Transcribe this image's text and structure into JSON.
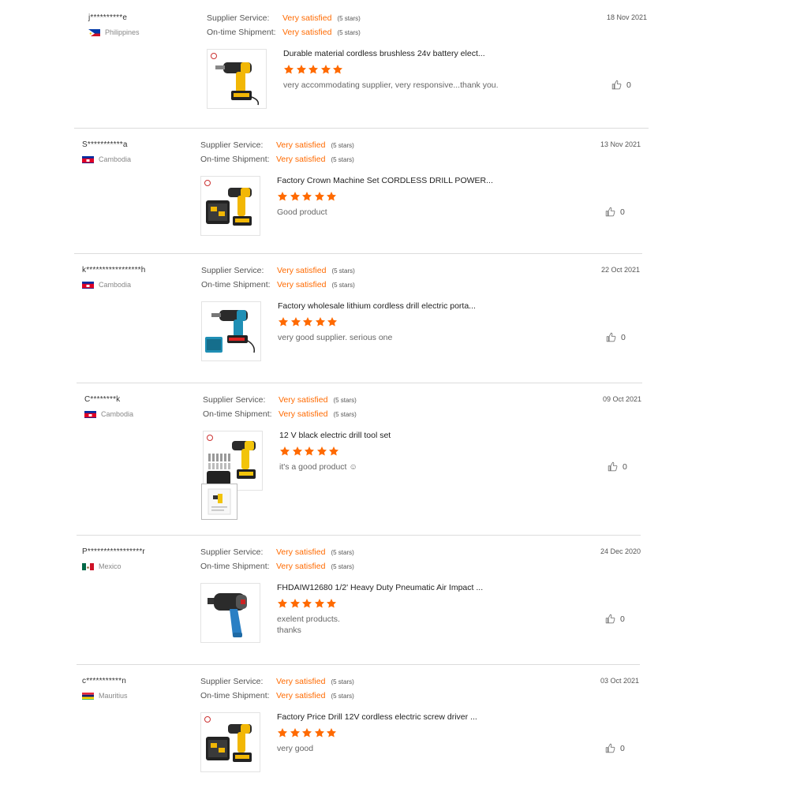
{
  "colors": {
    "accent": "#ff6a00",
    "divider": "#dcdcdc"
  },
  "reviews": [
    {
      "user": "j**********e",
      "country": "Philippines",
      "flag": "ph-flag-icon",
      "supplier_label": "Supplier Service:",
      "supplier_value": "Very satisfied",
      "supplier_stars": "(5 stars)",
      "shipment_label": "On-time Shipment:",
      "shipment_value": "Very satisfied",
      "shipment_stars": "(5 stars)",
      "date": "18 Nov 2021",
      "product_title": "Durable material cordless brushless 24v battery elect...",
      "rating": 5,
      "comment_lines": [
        "very accommodating supplier, very responsive...thank you."
      ],
      "likes": "0"
    },
    {
      "user": "S***********a",
      "country": "Cambodia",
      "flag": "kh-flag-icon",
      "supplier_label": "Supplier Service:",
      "supplier_value": "Very satisfied",
      "supplier_stars": "(5 stars)",
      "shipment_label": "On-time Shipment:",
      "shipment_value": "Very satisfied",
      "shipment_stars": "(5 stars)",
      "date": "13 Nov 2021",
      "product_title": "Factory Crown Machine Set CORDLESS DRILL POWER...",
      "rating": 5,
      "comment_lines": [
        "Good product"
      ],
      "likes": "0"
    },
    {
      "user": "k*****************h",
      "country": "Cambodia",
      "flag": "kh-flag-icon",
      "supplier_label": "Supplier Service:",
      "supplier_value": "Very satisfied",
      "supplier_stars": "(5 stars)",
      "shipment_label": "On-time Shipment:",
      "shipment_value": "Very satisfied",
      "shipment_stars": "(5 stars)",
      "date": "22 Oct 2021",
      "product_title": "Factory wholesale lithium cordless drill electric porta...",
      "rating": 5,
      "comment_lines": [
        "very good supplier. serious one"
      ],
      "likes": "0"
    },
    {
      "user": "C********k",
      "country": "Cambodia",
      "flag": "kh-flag-icon",
      "supplier_label": "Supplier Service:",
      "supplier_value": "Very satisfied",
      "supplier_stars": "(5 stars)",
      "shipment_label": "On-time Shipment:",
      "shipment_value": "Very satisfied",
      "shipment_stars": "(5 stars)",
      "date": "09 Oct 2021",
      "product_title": "12 V black electric drill tool set",
      "rating": 5,
      "comment_lines": [
        "it's a good product ☺"
      ],
      "likes": "0",
      "has_attachment": true
    },
    {
      "user": "P*****************r",
      "country": "Mexico",
      "flag": "mx-flag-icon",
      "supplier_label": "Supplier Service:",
      "supplier_value": "Very satisfied",
      "supplier_stars": "(5 stars)",
      "shipment_label": "On-time Shipment:",
      "shipment_value": "Very satisfied",
      "shipment_stars": "(5 stars)",
      "date": "24 Dec 2020",
      "product_title": "FHDAIW12680 1/2' Heavy Duty Pneumatic Air Impact ...",
      "rating": 5,
      "comment_lines": [
        "exelent products.",
        "thanks"
      ],
      "likes": "0"
    },
    {
      "user": "c***********n",
      "country": "Mauritius",
      "flag": "mu-flag-icon",
      "supplier_label": "Supplier Service:",
      "supplier_value": "Very satisfied",
      "supplier_stars": "(5 stars)",
      "shipment_label": "On-time Shipment:",
      "shipment_value": "Very satisfied",
      "shipment_stars": "(5 stars)",
      "date": "03 Oct 2021",
      "product_title": "Factory Price Drill 12V cordless electric screw driver ...",
      "rating": 5,
      "comment_lines": [
        "very good"
      ],
      "likes": "0"
    }
  ]
}
